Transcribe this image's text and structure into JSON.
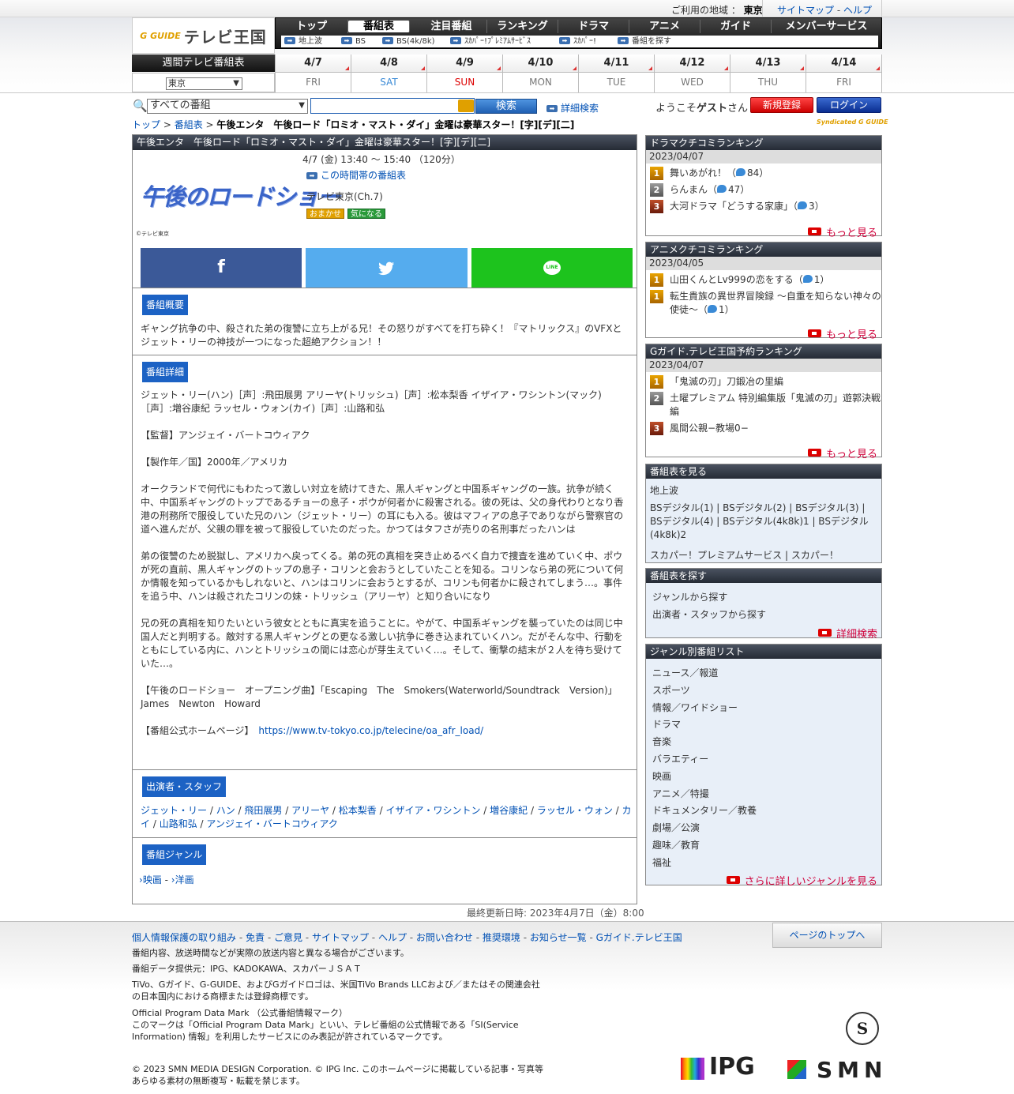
{
  "header": {
    "region_label": "ご利用の地域 ：",
    "region": "東京",
    "sitemap": "サイトマップ",
    "sep": "-",
    "help": "ヘルプ",
    "logo_g": "G GUIDE",
    "logo_text": "テレビ王国"
  },
  "nav": {
    "items": [
      "トップ",
      "番組表",
      "注目番組",
      "ランキング",
      "ドラマ",
      "アニメ",
      "ガイド",
      "メンバーサービス"
    ],
    "sub": [
      "地上波",
      "BS",
      "BS(4k/8k)",
      "ｽｶﾊﾟｰ!ﾌﾟﾚﾐｱﾑｻｰﾋﾞｽ",
      "ｽｶﾊﾟｰ!",
      "番組を探す"
    ]
  },
  "week": {
    "label": "週間テレビ番組表",
    "region_select": "東京",
    "days": [
      {
        "date": "4/7",
        "wd": "FRI",
        "color": "#777"
      },
      {
        "date": "4/8",
        "wd": "SAT",
        "color": "#3a8ad6"
      },
      {
        "date": "4/9",
        "wd": "SUN",
        "color": "#d00"
      },
      {
        "date": "4/10",
        "wd": "MON",
        "color": "#777"
      },
      {
        "date": "4/11",
        "wd": "TUE",
        "color": "#777"
      },
      {
        "date": "4/12",
        "wd": "WED",
        "color": "#777"
      },
      {
        "date": "4/13",
        "wd": "THU",
        "color": "#777"
      },
      {
        "date": "4/14",
        "wd": "FRI",
        "color": "#777"
      }
    ]
  },
  "search": {
    "category": "すべての番組",
    "button": "検索",
    "detail": "詳細検索"
  },
  "user": {
    "welcome_pre": "ようこそ",
    "welcome_name": "ゲスト",
    "welcome_post": "さん",
    "register": "新規登録",
    "login": "ログイン"
  },
  "breadcrumb": {
    "top": "トップ",
    "sep": " > ",
    "list": "番組表",
    "current": "午後エンタ　午後ロード「ロミオ・マスト・ダイ」金曜は豪華スター！[字][デ][二]"
  },
  "syndicated": "Syndicated G GUIDE",
  "program": {
    "header": "午後エンタ　午後ロード「ロミオ・マスト・ダイ」金曜は豪華スター！[字][デ][二]",
    "logo_text": "午後のロードショー",
    "copyright": "©テレビ東京",
    "datetime": "4/7 (金) 13:40 ～ 15:40 （120分）",
    "timeslot_link": "この時間帯の番組表",
    "channel": "テレビ東京(Ch.7)",
    "badge1": "おまかせ",
    "badge2": "気になる",
    "social": {
      "facebook": "f",
      "line": "LINE"
    },
    "summary_title": "番組概要",
    "summary": "ギャング抗争の中、殺された弟の復讐に立ち上がる兄！その怒りがすべてを打ち砕く！『マトリックス』のVFXとジェット・リーの神技が一つになった超絶アクション！！",
    "detail_title": "番組詳細",
    "detail_cast": "ジェット・リー(ハン)［声］:飛田展男 アリーヤ(トリッシュ)［声］:松本梨香 イザイア・ワシントン(マック)［声］:増谷康紀 ラッセル・ウォン(カイ)［声］:山路和弘",
    "detail_director": "【監督】アンジェイ・バートコウィアク",
    "detail_year": "【製作年／国】2000年／アメリカ",
    "detail_p1": "オークランドで何代にもわたって激しい対立を続けてきた、黒人ギャングと中国系ギャングの一族。抗争が続く中、中国系ギャングのトップであるチョーの息子・ポウが何者かに殺害される。彼の死は、父の身代わりとなり香港の刑務所で服役していた兄のハン（ジェット・リー）の耳にも入る。彼はマフィアの息子でありながら警察官の道へ進んだが、父親の罪を被って服役していたのだった。かつてはタフさが売りの名刑事だったハンは",
    "detail_p2": "弟の復讐のため脱獄し、アメリカへ戻ってくる。弟の死の真相を突き止めるべく自力で捜査を進めていく中、ポウが死の直前、黒人ギャングのトップの息子・コリンと会おうとしていたことを知る。コリンなら弟の死について何か情報を知っているかもしれないと、ハンはコリンに会おうとするが、コリンも何者かに殺されてしまう…。事件を追う中、ハンは殺されたコリンの妹・トリッシュ（アリーヤ）と知り合いになり",
    "detail_p3": "兄の死の真相を知りたいという彼女とともに真実を追うことに。やがて、中国系ギャングを襲っていたのは同じ中国人だと判明する。敵対する黒人ギャングとの更なる激しい抗争に巻き込まれていくハン。だがそんな中、行動をともにしている内に、ハンとトリッシュの間には恋心が芽生えていく…。そして、衝撃の結末が２人を待ち受けていた…。",
    "detail_song": "【午後のロードショー　オープニング曲】「Escaping　The　Smokers(Waterworld/Soundtrack　Version)」　James　Newton　Howard",
    "detail_hp_label": "【番組公式ホームページ】",
    "detail_hp_url": "https://www.tv-tokyo.co.jp/telecine/oa_afr_load/",
    "cast_title": "出演者・スタッフ",
    "cast": [
      "ジェット・リー",
      "ハン",
      "飛田展男",
      "アリーヤ",
      "松本梨香",
      "イザイア・ワシントン",
      "増谷康紀",
      "ラッセル・ウォン",
      "カイ",
      "山路和弘",
      "アンジェイ・バートコウィアク"
    ],
    "genre_title": "番組ジャンル",
    "genre1": "映画",
    "genre_sep": " - ",
    "genre2": "洋画"
  },
  "updated": "最終更新日時: 2023年4月7日（金）8:00",
  "sidebar": {
    "drama": {
      "title": "ドラマクチコミランキング",
      "date": "2023/04/07",
      "items": [
        {
          "rank": "1",
          "title": "舞いあがれ！（",
          "count": "84）"
        },
        {
          "rank": "2",
          "title": "らんまん（",
          "count": "47）"
        },
        {
          "rank": "3",
          "title": "大河ドラマ「どうする家康」（",
          "count": "3）"
        }
      ],
      "more": "もっと見る"
    },
    "anime": {
      "title": "アニメクチコミランキング",
      "date": "2023/04/05",
      "items": [
        {
          "rank": "1",
          "title": "山田くんとLv999の恋をする（",
          "count": "1）"
        },
        {
          "rank": "1",
          "title": "転生貴族の異世界冒険録 ～自重を知らない神々の使徒～（",
          "count": "1）"
        }
      ],
      "more": "もっと見る"
    },
    "reserve": {
      "title": "Gガイド.テレビ王国予約ランキング",
      "date": "2023/04/07",
      "items": [
        {
          "rank": "1",
          "title": "「鬼滅の刃」刀鍛冶の里編"
        },
        {
          "rank": "2",
          "title": "土曜プレミアム 特別編集版「鬼滅の刃」遊郭決戦編"
        },
        {
          "rank": "3",
          "title": "風間公親−教場0−"
        }
      ],
      "more": "もっと見る"
    },
    "view": {
      "title": "番組表を見る",
      "terrestrial": "地上波",
      "bs": "BSデジタル(1) | BSデジタル(2) | BSデジタル(3) | BSデジタル(4) | BSデジタル(4k8k)1 | BSデジタル(4k8k)2",
      "sky": "スカパー！プレミアムサービス | スカパー！"
    },
    "find": {
      "title": "番組表を探す",
      "genre": "ジャンルから探す",
      "cast": "出演者・スタッフから探す",
      "detail": "詳細検索"
    },
    "genres": {
      "title": "ジャンル別番組リスト",
      "items": [
        "ニュース／報道",
        "スポーツ",
        "情報／ワイドショー",
        "ドラマ",
        "音楽",
        "バラエティー",
        "映画",
        "アニメ／特撮",
        "ドキュメンタリー／教養",
        "劇場／公演",
        "趣味／教育",
        "福祉"
      ],
      "more": "さらに詳しいジャンルを見る"
    }
  },
  "footer": {
    "links": [
      "個人情報保護の取り組み",
      "免責",
      "ご意見",
      "サイトマップ",
      "ヘルプ",
      "お問い合わせ",
      "推奨環境",
      "お知らせ一覧",
      "Gガイド.テレビ王国"
    ],
    "pagetop": "ページのトップへ",
    "note1": "番組内容、放送時間などが実際の放送内容と異なる場合がございます。",
    "note2": "番組データ提供元：IPG、KADOKAWA、スカパーＪＳＡＴ",
    "note3": "TiVo、Gガイド、G-GUIDE、およびGガイドロゴは、米国TiVo Brands LLCおよび／またはその関連会社の日本国内における商標または登録商標です。",
    "note4": "Official Program Data Mark （公式番組情報マーク）",
    "note5": "このマークは「Official Program Data Mark」といい、テレビ番組の公式情報である「SI(Service Information) 情報」を利用したサービスにのみ表記が許されているマークです。",
    "copyright": "© 2023 SMN MEDIA DESIGN Corporation. © IPG Inc. このホームページに掲載している記事・写真等 あらゆる素材の無断複写・転載を禁じます。",
    "ipg": "IPG",
    "smn": "SMN",
    "seal": "S"
  }
}
